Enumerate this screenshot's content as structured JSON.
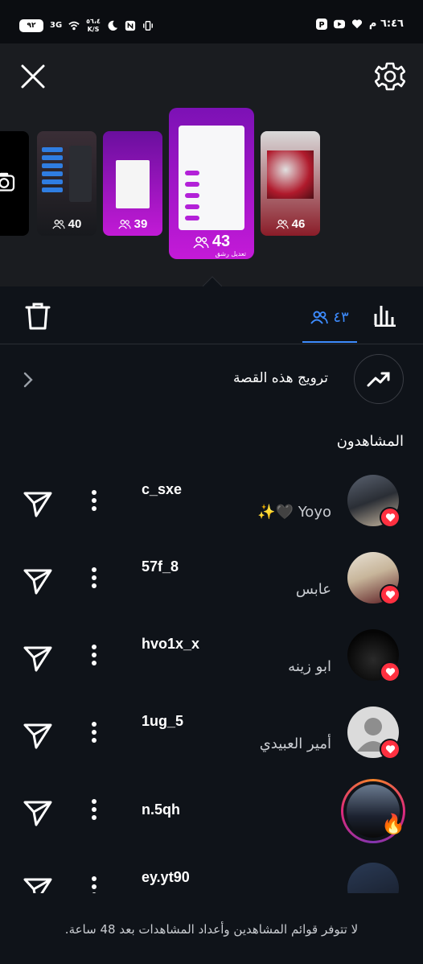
{
  "status_bar": {
    "battery": "٩٢",
    "network": "3G",
    "speed_value": "٥٦،٤",
    "speed_unit": "K/S",
    "time": "٦:٤٦ م"
  },
  "thumbs": {
    "main_count": "43",
    "main_caption": "تعديل رشق",
    "t1_count": "40",
    "t2_count": "39",
    "t3_count": "46"
  },
  "tabs": {
    "viewers_count": "٤٣"
  },
  "promote": {
    "label": "ترويج هذه القصة"
  },
  "section_title": "المشاهدون",
  "viewers": [
    {
      "username": "c_sxe",
      "display": "Yoyo 🖤✨"
    },
    {
      "username": "57f_8",
      "display": "عابس"
    },
    {
      "username": "hvo1x_x",
      "display": "ابو زينه"
    },
    {
      "username": "1ug_5",
      "display": "أمير العبيدي"
    },
    {
      "username": "n.5qh",
      "display": ""
    },
    {
      "username": "ey.yt90",
      "display": ""
    }
  ],
  "footer": "لا تتوفر قوائم المشاهدين وأعداد المشاهدات بعد 48 ساعة.",
  "colors": {
    "accent": "#3d8bfd",
    "heart": "#ff3040",
    "background": "#0f1319"
  }
}
